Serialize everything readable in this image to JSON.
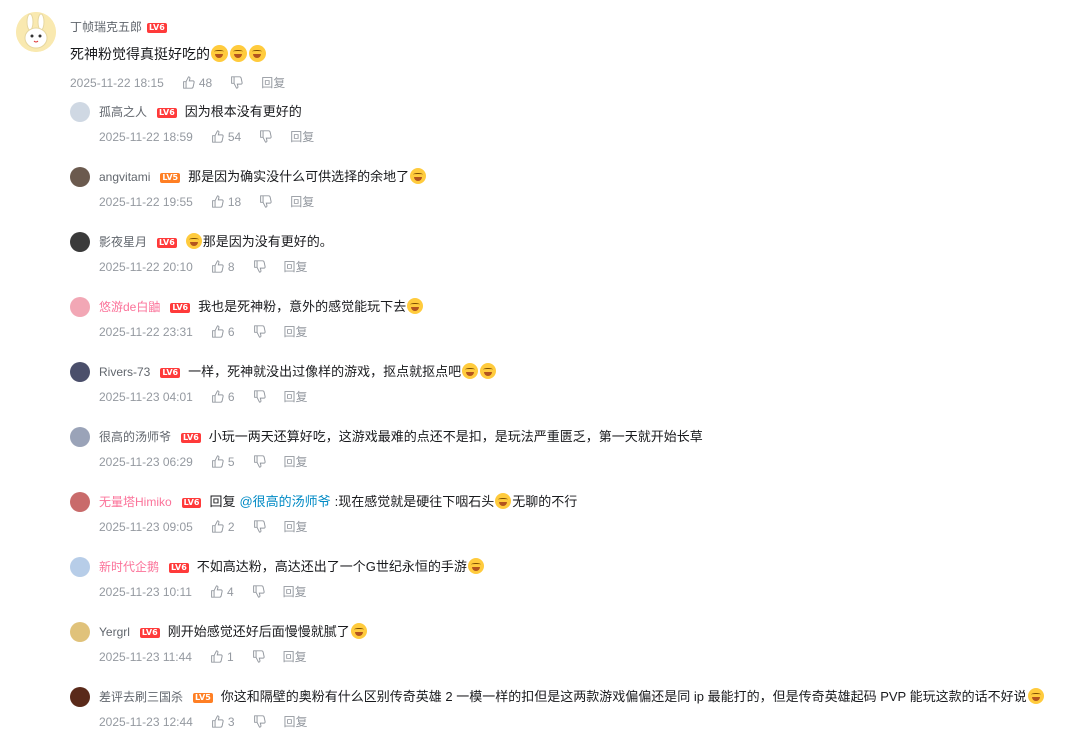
{
  "main": {
    "username": "丁帧瑞克五郎",
    "level": "LV6",
    "content": "死神粉觉得真挺好吃的",
    "time": "2025-11-22 18:15",
    "likes": "48",
    "reply_label": "回复"
  },
  "replies": [
    {
      "user": "孤高之人",
      "level": "LV6",
      "text": "因为根本没有更好的",
      "time": "2025-11-22 18:59",
      "likes": "54",
      "reply_label": "回复"
    },
    {
      "user": "angvitami",
      "level": "LV5",
      "text": "那是因为确实没什么可供选择的余地了",
      "time": "2025-11-22 19:55",
      "likes": "18",
      "reply_label": "回复"
    },
    {
      "user": "影夜星月",
      "level": "LV6",
      "text": "那是因为没有更好的。",
      "time": "2025-11-22 20:10",
      "likes": "8",
      "reply_label": "回复"
    },
    {
      "user": "悠游de白鼬",
      "level": "LV6",
      "text": "我也是死神粉，意外的感觉能玩下去",
      "time": "2025-11-22 23:31",
      "likes": "6",
      "reply_label": "回复"
    },
    {
      "user": "Rivers-73",
      "level": "LV6",
      "text": "一样，死神就没出过像样的游戏，抠点就抠点吧",
      "time": "2025-11-23 04:01",
      "likes": "6",
      "reply_label": "回复"
    },
    {
      "user": "很高的汤师爷",
      "level": "LV6",
      "text": "小玩一两天还算好吃，这游戏最难的点还不是扣，是玩法严重匮乏，第一天就开始长草",
      "time": "2025-11-23 06:29",
      "likes": "5",
      "reply_label": "回复"
    },
    {
      "user": "无量塔Himiko",
      "level": "LV6",
      "reply_prefix": "回复",
      "mention": "@很高的汤师爷",
      "text": ":现在感觉就是硬往下咽石头",
      "text2": "无聊的不行",
      "time": "2025-11-23 09:05",
      "likes": "2",
      "reply_label": "回复"
    },
    {
      "user": "新时代企鹅",
      "level": "LV6",
      "text": "不如高达粉，高达还出了一个G世纪永恒的手游",
      "time": "2025-11-23 10:11",
      "likes": "4",
      "reply_label": "回复"
    },
    {
      "user": "Yergrl",
      "level": "LV6",
      "text": "刚开始感觉还好后面慢慢就腻了",
      "time": "2025-11-23 11:44",
      "likes": "1",
      "reply_label": "回复"
    },
    {
      "user": "差评去刷三国杀",
      "level": "LV5",
      "text": "你这和隔壁的奥粉有什么区别传奇英雄 2 一模一样的扣但是这两款游戏偏偏还是同 ip 最能打的，但是传奇英雄起码 PVP 能玩这款的话不好说",
      "time": "2025-11-23 12:44",
      "likes": "3",
      "reply_label": "回复"
    }
  ],
  "colors": {
    "lv6": "#ff3a3a",
    "lv5": "#ff7f24",
    "pink_name": "#fb7299",
    "mention": "#008ac5"
  }
}
